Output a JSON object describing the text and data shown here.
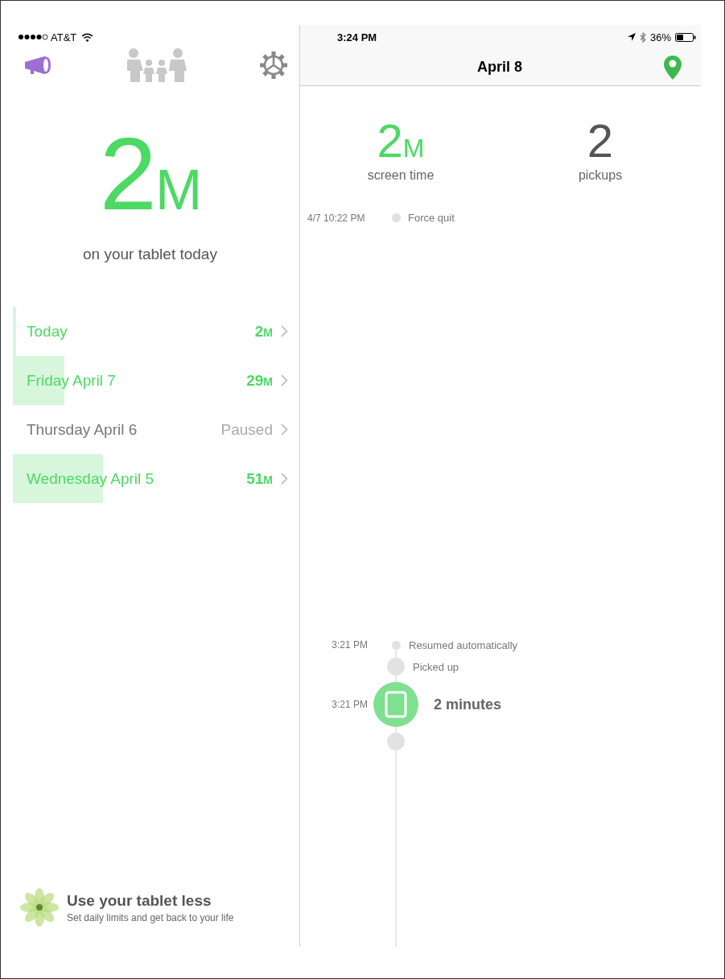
{
  "status_bar": {
    "carrier": "AT&T",
    "time": "3:24 PM",
    "battery": "36%"
  },
  "summary": {
    "value": "2",
    "unit": "M",
    "caption": "on your tablet today"
  },
  "days": [
    {
      "label": "Today",
      "value": "2",
      "unit": "M",
      "paused": false,
      "level": 0.012
    },
    {
      "label": "Friday April 7",
      "value": "29",
      "unit": "M",
      "paused": false,
      "level": 0.18
    },
    {
      "label": "Thursday April 6",
      "value": "Paused",
      "paused": true,
      "level": 0
    },
    {
      "label": "Wednesday April 5",
      "value": "51",
      "unit": "M",
      "paused": false,
      "level": 0.314
    }
  ],
  "promo": {
    "title": "Use your tablet less",
    "subtitle": "Set daily limits and get back to your life"
  },
  "detail": {
    "title": "April 8",
    "stats": [
      {
        "value": "2",
        "unit": "M",
        "label": "screen time",
        "kind": "time"
      },
      {
        "value": "2",
        "label": "pickups",
        "kind": "count"
      }
    ],
    "first_event": {
      "time": "4/7 10:22 PM",
      "text": "Force quit"
    },
    "events": [
      {
        "kind": "small",
        "time": "3:21 PM",
        "text": "Resumed automatically"
      },
      {
        "kind": "dot",
        "text": "Picked up"
      },
      {
        "kind": "session",
        "time": "3:21 PM",
        "text": "2 minutes"
      },
      {
        "kind": "dot"
      }
    ]
  }
}
